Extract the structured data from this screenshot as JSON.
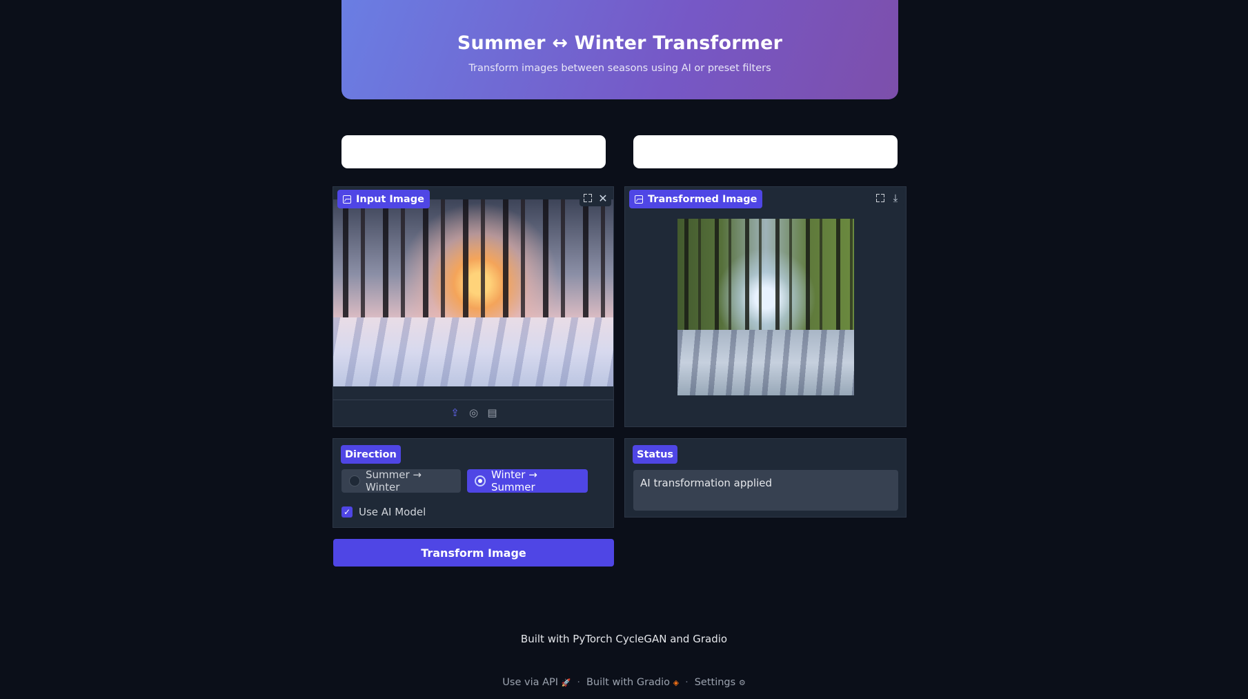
{
  "header": {
    "title": "Summer ↔ Winter Transformer",
    "subtitle": "Transform images between seasons using AI or preset filters"
  },
  "input_image": {
    "label": "Input Image",
    "icon": "image-icon",
    "actions": [
      "fullscreen-icon",
      "close-icon"
    ],
    "sources": [
      "upload-icon",
      "webcam-icon",
      "clipboard-icon"
    ]
  },
  "output_image": {
    "label": "Transformed Image",
    "icon": "image-icon",
    "actions": [
      "fullscreen-icon",
      "download-icon"
    ]
  },
  "direction": {
    "label": "Direction",
    "options": [
      "Summer → Winter",
      "Winter → Summer"
    ],
    "selected": "Winter → Summer"
  },
  "use_ai": {
    "label": "Use AI Model",
    "checked": true
  },
  "transform_button": {
    "label": "Transform Image"
  },
  "status": {
    "label": "Status",
    "value": "AI transformation applied"
  },
  "footer": {
    "note": "Built with PyTorch CycleGAN and Gradio",
    "links": [
      {
        "label": "Use via API",
        "icon": "rocket-icon"
      },
      {
        "label": "Built with Gradio",
        "icon": "gradio-logo-icon"
      },
      {
        "label": "Settings",
        "icon": "gear-icon"
      }
    ],
    "separator": "·"
  },
  "colors": {
    "background": "#0b0f19",
    "panel": "#1f2937",
    "accent": "#4f46e5",
    "header_gradient_start": "#6a7ee3",
    "header_gradient_end": "#7d4fab"
  }
}
